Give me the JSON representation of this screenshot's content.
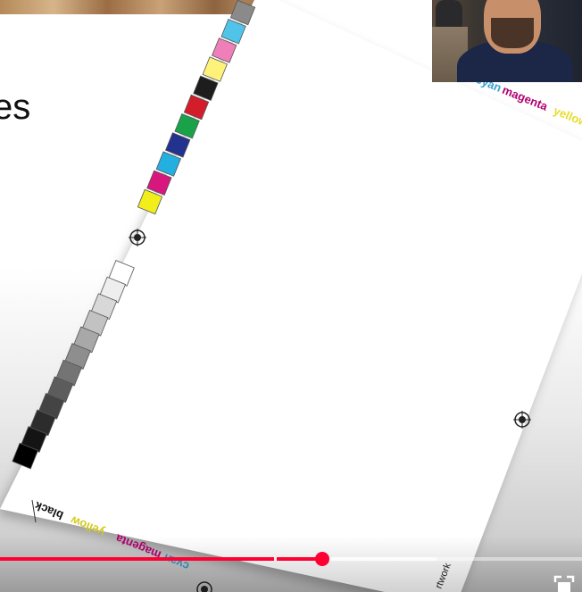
{
  "slide": {
    "heading_fragment": "es"
  },
  "sheet": {
    "label_top_cyan": "cyan",
    "label_top_magenta": "magenta",
    "label_top_yellow": "yellow",
    "label_bottom_black": "black",
    "label_bottom_yellow": "yellow",
    "label_bottom_magenta": "magenta",
    "label_bottom_cyan": "cyan",
    "label_artwork": "rtwork",
    "color_patches": [
      "#8a8a8a",
      "#4fc3e8",
      "#ee7fb8",
      "#fff27a",
      "#1d1d1d",
      "#d41d2a",
      "#1aa24a",
      "#23318f",
      "#23b0e0",
      "#d8177e",
      "#f2ee1c"
    ],
    "gray_patches": [
      "#ffffff",
      "#eeeeee",
      "#d8d8d8",
      "#c2c2c2",
      "#a8a8a8",
      "#8e8e8e",
      "#747474",
      "#5c5c5c",
      "#444444",
      "#2c2c2c",
      "#141414",
      "#000000"
    ]
  },
  "video": {
    "progress_played_fraction": 0.553,
    "progress_buffered_fraction": 0.75,
    "chapter_gap_fraction": 0.471,
    "accent_color": "#ff0033"
  },
  "webcam": {
    "shown": true
  },
  "icons": {
    "fullscreen": "fullscreen-icon",
    "registration_mark": "registration-mark-icon"
  }
}
